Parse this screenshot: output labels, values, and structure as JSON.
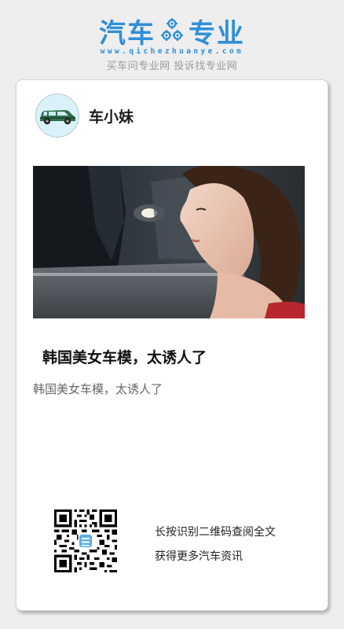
{
  "header": {
    "brand_left": "汽车",
    "brand_right": "专业",
    "url": "www.qichezhuanye.com",
    "slogan": "买车问专业网 投诉找专业网",
    "gear_icon": "gear-cluster-icon",
    "brand_color": "#2f8fd8"
  },
  "card": {
    "author_name": "车小妹",
    "avatar_icon": "green-car-icon",
    "article_title": "韩国美女车模，太诱人了",
    "article_summary": "韩国美女车模，太诱人了",
    "qr_icon": "qr-code-icon",
    "qr_line1": "长按识别二维码查阅全文",
    "qr_line2": "获得更多汽车资讯"
  }
}
